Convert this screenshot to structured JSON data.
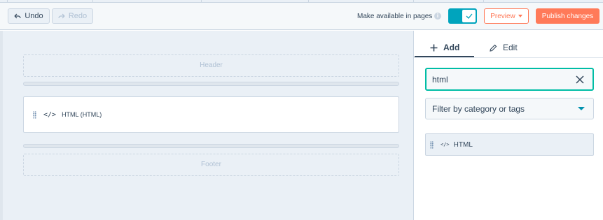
{
  "toolbar": {
    "undo_label": "Undo",
    "redo_label": "Redo",
    "make_available_label": "Make available in pages",
    "make_available_on": true,
    "preview_label": "Preview",
    "publish_label": "Publish changes"
  },
  "canvas": {
    "header_label": "Header",
    "footer_label": "Footer",
    "module": {
      "icon": "</>",
      "label": "HTML (HTML)"
    }
  },
  "panel": {
    "tabs": [
      {
        "label": "Add",
        "icon": "plus-icon",
        "active": true
      },
      {
        "label": "Edit",
        "icon": "pencil-icon",
        "active": false
      }
    ],
    "search_value": "html",
    "filter_placeholder": "Filter by category or tags",
    "results": [
      {
        "icon": "</>",
        "label": "HTML"
      }
    ]
  },
  "colors": {
    "accent": "#ff7a59",
    "toggle": "#00a4bd",
    "search_focus": "#00bda5",
    "text": "#33475b"
  }
}
